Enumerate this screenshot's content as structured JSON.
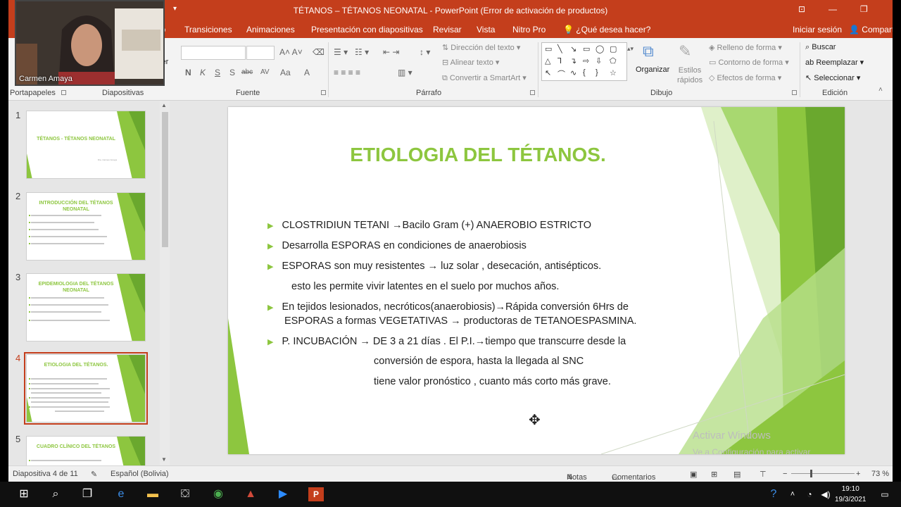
{
  "window": {
    "title": "TÉTANOS – TÉTANOS NEONATAL  -  PowerPoint (Error de activación de productos)",
    "sign_in": "Iniciar sesión",
    "share": "Compartir"
  },
  "menu_tabs": [
    "ño",
    "Transiciones",
    "Animaciones",
    "Presentación con diapositivas",
    "Revisar",
    "Vista",
    "Nitro Pro",
    "¿Qué desea hacer?"
  ],
  "ribbon": {
    "groups": {
      "clipboard": "Portapapeles",
      "slides": "Diapositivas",
      "font": "Fuente",
      "paragraph": "Párrafo",
      "drawing": "Dibujo",
      "editing": "Edición"
    },
    "slides_partial_label": "cer",
    "font_format": [
      "N",
      "K",
      "S",
      "S",
      "abc",
      "AV",
      "Aa",
      "A"
    ],
    "paragraph_commands": {
      "text_direction": "Dirección del texto",
      "align_text": "Alinear texto",
      "smartart": "Convertir a SmartArt"
    },
    "drawing_commands": {
      "arrange": "Organizar",
      "quick_styles": "Estilos rápidos",
      "shape_fill": "Relleno de forma",
      "shape_outline": "Contorno de forma",
      "shape_effects": "Efectos de forma"
    },
    "editing_commands": {
      "find": "Buscar",
      "replace": "Reemplazar",
      "select": "Seleccionar"
    }
  },
  "webcam": {
    "name": "Carmen Amaya"
  },
  "thumbnails": [
    {
      "num": "1",
      "title": "TÉTANOS - TÉTANOS NEONATAL",
      "sub": "Dra. Carmen Amaya"
    },
    {
      "num": "2",
      "title": "INTRODUCCIÓN DEL TÉTANOS NEONATAL"
    },
    {
      "num": "3",
      "title": "EPIDEMIOLOGIA DEL TÉTANOS NEONATAL"
    },
    {
      "num": "4",
      "title": "ETIOLOGIA DEL  TÉTANOS."
    },
    {
      "num": "5",
      "title": "CUADRO CLÍNICO DEL TÉTANOS"
    }
  ],
  "slide": {
    "title": "ETIOLOGIA DEL  TÉTANOS.",
    "bullets": [
      "CLOSTRIDIUN TETANI →Bacilo Gram (+) ANAEROBIO ESTRICTO",
      "Desarrolla ESPORAS en condiciones de anaerobiosis",
      "ESPORAS son muy resistentes → luz solar , desecación, antisépticos.",
      "esto les  permite vivir latentes en el suelo por muchos años.",
      "En tejidos lesionados, necróticos(anaerobiosis)→Rápida conversión 6Hrs de",
      "ESPORAS a formas VEGETATIVAS → productoras de TETANOESPASMINA.",
      "P. INCUBACIÓN → DE 3 a 21 días . El P.I.→tiempo que transcurre desde la",
      "conversión de espora, hasta la llegada al SNC",
      "tiene valor pronóstico , cuanto más corto más grave."
    ],
    "watermark": [
      "Activar Windows",
      "Ve a Configuración para activar Windows."
    ]
  },
  "status_bar": {
    "slide_indicator": "Diapositiva 4 de 11",
    "language": "Español (Bolivia)",
    "notes": "Notas",
    "comments": "Comentarios",
    "zoom": "73 %"
  },
  "taskbar": {
    "time": "19:10",
    "date": "19/3/2021"
  },
  "colors": {
    "accent": "#c43e1c",
    "slide_green": "#8dc63f"
  }
}
